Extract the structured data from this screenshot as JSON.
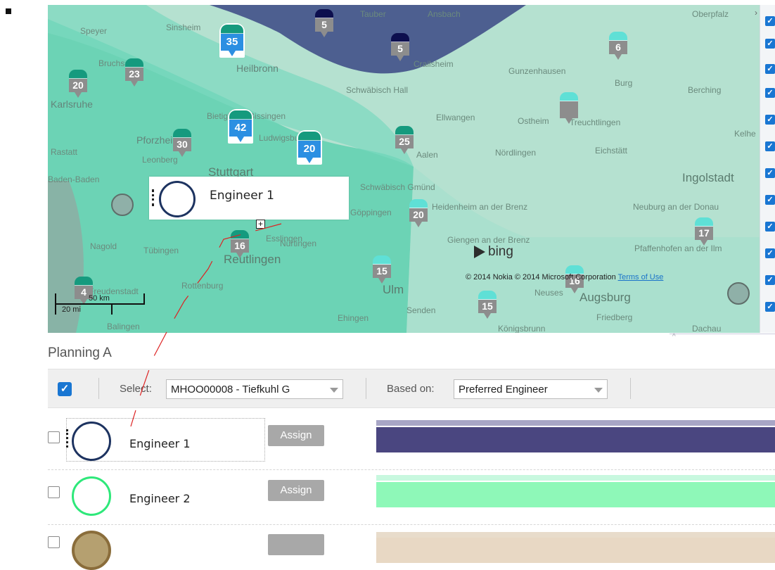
{
  "map": {
    "places": {
      "heilbronn": "Heilbronn",
      "karlsruhe": "Karlsruhe",
      "pforzheim": "Pforzheim",
      "stuttgart": "Stuttgart",
      "baden_baden": "Baden-Baden",
      "leonberg": "Leonberg",
      "schwabisch_hall": "Schwäbisch Hall",
      "crailsheim": "Crailsheim",
      "ansbach": "Ansbach",
      "gunzenhausen": "Gunzenhausen",
      "ellwangen": "Ellwangen",
      "aalen": "Aalen",
      "nordlingen": "Nördlingen",
      "eichstatt": "Eichstätt",
      "ingolstadt": "Ingolstadt",
      "schwabisch_gmund": "Schwäbisch Gmünd",
      "heidenheim": "Heidenheim an der Brenz",
      "neuburg": "Neuburg an der Donau",
      "giengen": "Giengen an der Brenz",
      "reutlingen": "Reutlingen",
      "tubingen": "Tübingen",
      "nagold": "Nagold",
      "ulm": "Ulm",
      "augsburg": "Augsburg",
      "friedberg": "Friedberg",
      "senden": "Senden",
      "konigsbrunn": "Königsbrunn",
      "oberpfalz": "Oberpfalz",
      "pfaffenhofen": "Pfaffenhofen an der Ilm",
      "treuchtlingen": "Treuchtlingen",
      "balingen": "Balingen",
      "dachau": "Dachau",
      "kelheim": "Kelhe",
      "berching": "Berching",
      "burg": "Burg",
      "ostheim": "Ostheim",
      "neuses": "Neuses",
      "rottenburg": "Rottenburg",
      "freudenstadt": "Freudenstadt",
      "ehingen": "Ehingen",
      "sinsheim": "Sinsheim",
      "speyer": "Speyer",
      "bruchsal": "Bruchsal",
      "tauber": "Tauber",
      "rastatt": "Rastatt",
      "nurtingen": "Nürtingen",
      "bietigheim": "Bietigheim-Bissingen",
      "ludwigsburg": "Ludwigsburg",
      "esslingen": "Esslingen",
      "goppingen": "Göppingen"
    },
    "pins": {
      "p35": "35",
      "p5a": "5",
      "p5b": "5",
      "p6": "6",
      "p23": "23",
      "p20a": "20",
      "p42": "42",
      "p20b": "20",
      "p30": "30",
      "p25": "25",
      "p20c": "20",
      "p16a": "16",
      "p17": "17",
      "p15a": "15",
      "p16b": "16",
      "p15b": "15",
      "p4": "4"
    },
    "bing": "bing",
    "copyright": "© 2014 Nokia © 2014 Microsoft Corporation",
    "terms": "Terms of Use",
    "scale_km": "50 km",
    "scale_mi": "20 mi",
    "drag_engineer": "Engineer 1"
  },
  "planning": {
    "title": "Planning A",
    "select_label": "Select:",
    "select_value": "MHOO00008 - Tiefkuhl G",
    "based_on_label": "Based on:",
    "based_on_value": "Preferred Engineer",
    "engineers": [
      {
        "name": "Engineer 1",
        "assign": "Assign",
        "ring_color": "#1d3360",
        "tl_top": "#a8a6c6",
        "tl_main": "#4a4680"
      },
      {
        "name": "Engineer 2",
        "assign": "Assign",
        "ring_color": "#2ee87a",
        "tl_top": "#c8f8df",
        "tl_main": "#8ef8b8"
      },
      {
        "name": "",
        "assign": "",
        "ring_color": "#8a6d3b",
        "tl_top": "#e8dccb",
        "tl_main": "#e8d8c4"
      }
    ]
  },
  "colors": {
    "zone_light": "#8dd9c2",
    "zone_teal": "#62d3b3",
    "zone_navy": "#4d5a8e",
    "checkbox_blue": "#1976d2"
  }
}
